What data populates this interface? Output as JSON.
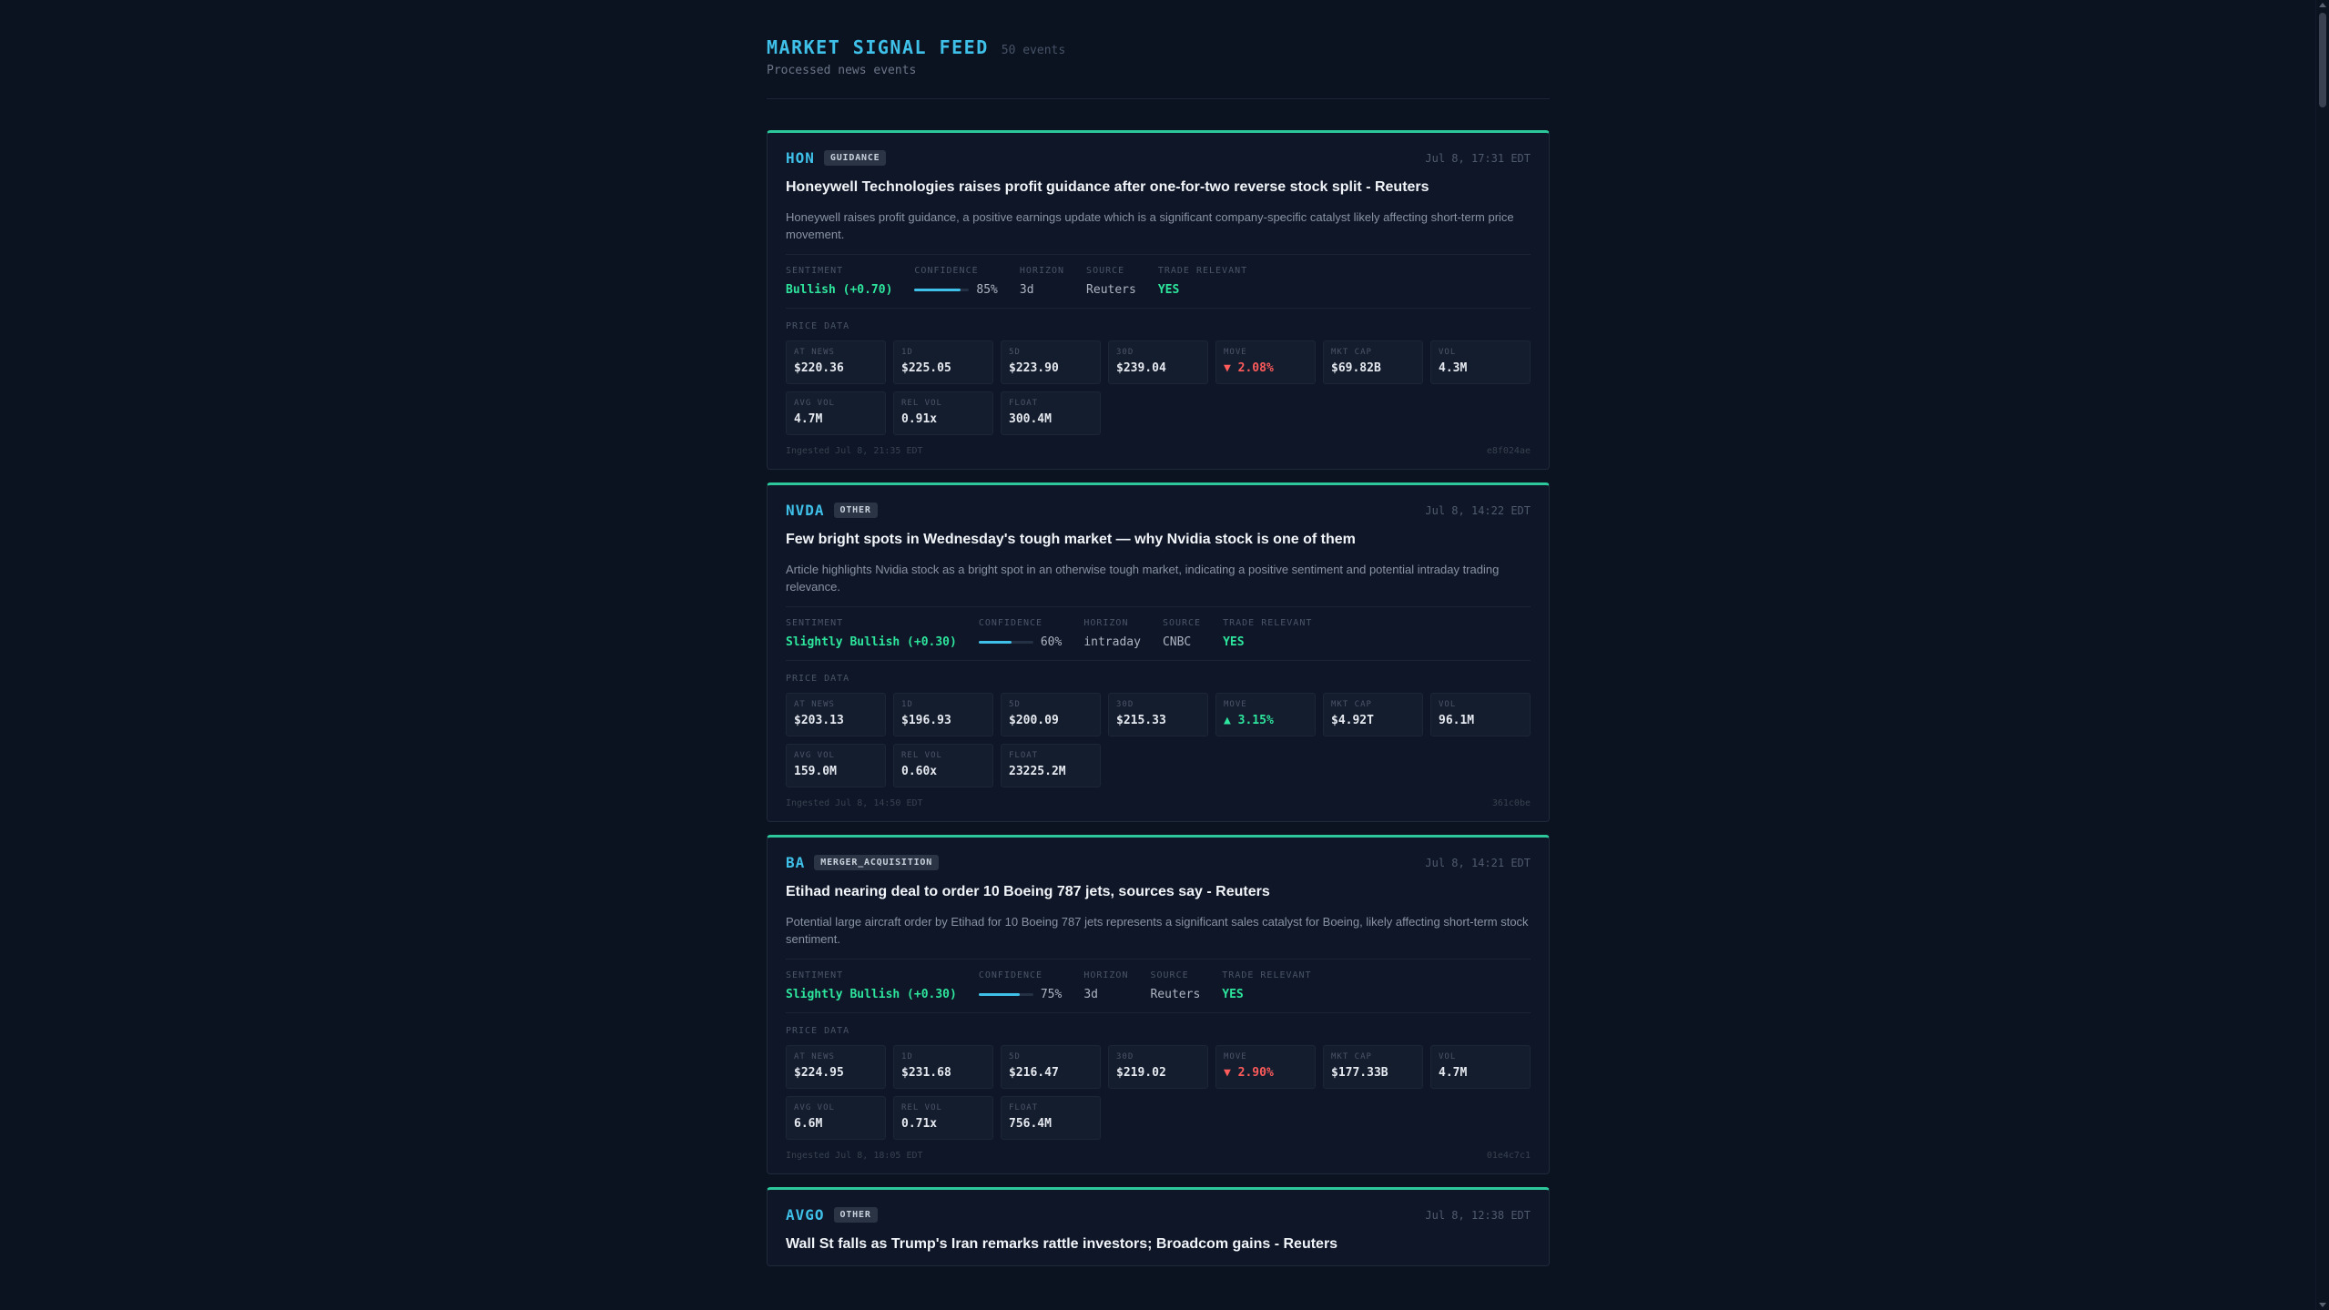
{
  "header": {
    "title": "MARKET SIGNAL FEED",
    "count": "50 events",
    "subtitle": "Processed news events"
  },
  "labels": {
    "sentiment": "SENTIMENT",
    "confidence": "CONFIDENCE",
    "horizon": "HORIZON",
    "source": "SOURCE",
    "trade_relevant": "TRADE RELEVANT",
    "price_data": "PRICE DATA"
  },
  "cards": [
    {
      "ticker": "HON",
      "tag": "GUIDANCE",
      "time": "Jul 8, 17:31 EDT",
      "headline": "Honeywell Technologies raises profit guidance after one-for-two reverse stock split - Reuters",
      "summary": "Honeywell raises profit guidance, a positive earnings update which is a significant company-specific catalyst likely affecting short-term price movement.",
      "sentiment": "Bullish (+0.70)",
      "confidence": "85%",
      "confidence_value": 0.85,
      "horizon": "3d",
      "source": "Reuters",
      "trade_relevant": "YES",
      "prices": [
        {
          "label": "AT NEWS",
          "value": "$220.36"
        },
        {
          "label": "1D",
          "value": "$225.05"
        },
        {
          "label": "5D",
          "value": "$223.90"
        },
        {
          "label": "30D",
          "value": "$239.04"
        },
        {
          "label": "MOVE",
          "value": "▼ 2.08%",
          "dir": "down"
        },
        {
          "label": "MKT CAP",
          "value": "$69.82B"
        },
        {
          "label": "VOL",
          "value": "4.3M"
        },
        {
          "label": "AVG VOL",
          "value": "4.7M"
        },
        {
          "label": "REL VOL",
          "value": "0.91x"
        },
        {
          "label": "FLOAT",
          "value": "300.4M"
        }
      ],
      "ingested": "Ingested Jul 8, 21:35 EDT",
      "id": "e8f024ae"
    },
    {
      "ticker": "NVDA",
      "tag": "OTHER",
      "time": "Jul 8, 14:22 EDT",
      "headline": "Few bright spots in Wednesday's tough market — why Nvidia stock is one of them",
      "summary": "Article highlights Nvidia stock as a bright spot in an otherwise tough market, indicating a positive sentiment and potential intraday trading relevance.",
      "sentiment": "Slightly Bullish (+0.30)",
      "confidence": "60%",
      "confidence_value": 0.6,
      "horizon": "intraday",
      "source": "CNBC",
      "trade_relevant": "YES",
      "prices": [
        {
          "label": "AT NEWS",
          "value": "$203.13"
        },
        {
          "label": "1D",
          "value": "$196.93"
        },
        {
          "label": "5D",
          "value": "$200.09"
        },
        {
          "label": "30D",
          "value": "$215.33"
        },
        {
          "label": "MOVE",
          "value": "▲ 3.15%",
          "dir": "up"
        },
        {
          "label": "MKT CAP",
          "value": "$4.92T"
        },
        {
          "label": "VOL",
          "value": "96.1M"
        },
        {
          "label": "AVG VOL",
          "value": "159.0M"
        },
        {
          "label": "REL VOL",
          "value": "0.60x"
        },
        {
          "label": "FLOAT",
          "value": "23225.2M"
        }
      ],
      "ingested": "Ingested Jul 8, 14:50 EDT",
      "id": "361c0be"
    },
    {
      "ticker": "BA",
      "tag": "MERGER_ACQUISITION",
      "time": "Jul 8, 14:21 EDT",
      "headline": "Etihad nearing deal to order 10 Boeing 787 jets, sources say - Reuters",
      "summary": "Potential large aircraft order by Etihad for 10 Boeing 787 jets represents a significant sales catalyst for Boeing, likely affecting short-term stock sentiment.",
      "sentiment": "Slightly Bullish (+0.30)",
      "confidence": "75%",
      "confidence_value": 0.75,
      "horizon": "3d",
      "source": "Reuters",
      "trade_relevant": "YES",
      "prices": [
        {
          "label": "AT NEWS",
          "value": "$224.95"
        },
        {
          "label": "1D",
          "value": "$231.68"
        },
        {
          "label": "5D",
          "value": "$216.47"
        },
        {
          "label": "30D",
          "value": "$219.02"
        },
        {
          "label": "MOVE",
          "value": "▼ 2.90%",
          "dir": "down"
        },
        {
          "label": "MKT CAP",
          "value": "$177.33B"
        },
        {
          "label": "VOL",
          "value": "4.7M"
        },
        {
          "label": "AVG VOL",
          "value": "6.6M"
        },
        {
          "label": "REL VOL",
          "value": "0.71x"
        },
        {
          "label": "FLOAT",
          "value": "756.4M"
        }
      ],
      "ingested": "Ingested Jul 8, 18:05 EDT",
      "id": "01e4c7c1"
    },
    {
      "ticker": "AVGO",
      "tag": "OTHER",
      "time": "Jul 8, 12:38 EDT",
      "headline": "Wall St falls as Trump's Iran remarks rattle investors; Broadcom gains - Reuters"
    }
  ]
}
